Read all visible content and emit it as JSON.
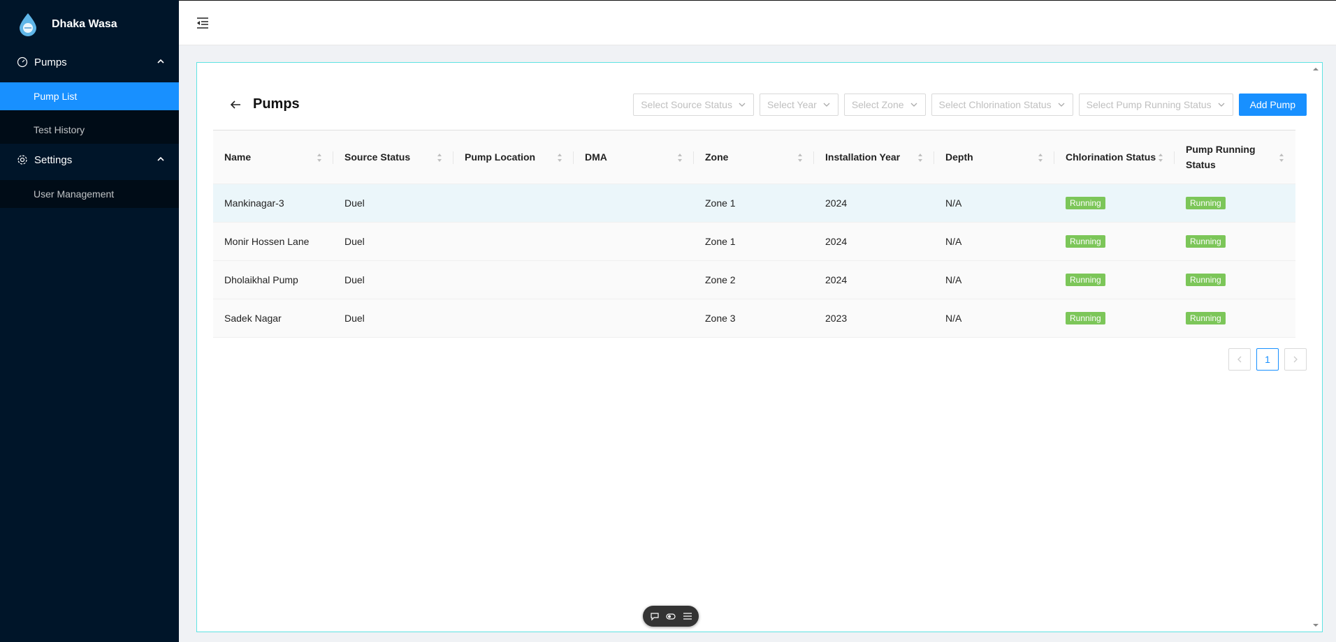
{
  "app": {
    "name": "Dhaka Wasa"
  },
  "sidebar": {
    "groups": [
      {
        "label": "Pumps",
        "icon": "dashboard-icon",
        "items": [
          {
            "label": "Pump List",
            "active": true
          },
          {
            "label": "Test History",
            "active": false
          }
        ]
      },
      {
        "label": "Settings",
        "icon": "gear-icon",
        "items": [
          {
            "label": "User Management",
            "active": false
          }
        ]
      }
    ]
  },
  "page": {
    "title": "Pumps"
  },
  "filters": {
    "source_status": "Select Source Status",
    "year": "Select Year",
    "zone": "Select Zone",
    "chlorination": "Select Chlorination Status",
    "pump_running": "Select Pump Running Status",
    "add_button": "Add Pump"
  },
  "table": {
    "columns": [
      "Name",
      "Source Status",
      "Pump Location",
      "DMA",
      "Zone",
      "Installation Year",
      "Depth",
      "Chlorination Status",
      "Pump Running Status"
    ],
    "rows": [
      [
        "Mankinagar-3",
        "Duel",
        "",
        "",
        "Zone 1",
        "2024",
        "N/A",
        "Running",
        "Running"
      ],
      [
        "Monir Hossen Lane",
        "Duel",
        "",
        "",
        "Zone 1",
        "2024",
        "N/A",
        "Running",
        "Running"
      ],
      [
        "Dholaikhal Pump",
        "Duel",
        "",
        "",
        "Zone 2",
        "2024",
        "N/A",
        "Running",
        "Running"
      ],
      [
        "Sadek Nagar",
        "Duel",
        "",
        "",
        "Zone 3",
        "2023",
        "N/A",
        "Running",
        "Running"
      ]
    ]
  },
  "pagination": {
    "current": "1"
  },
  "colors": {
    "sidebar_bg": "#001529",
    "primary": "#1890ff",
    "running_tag": "#7cc659"
  }
}
